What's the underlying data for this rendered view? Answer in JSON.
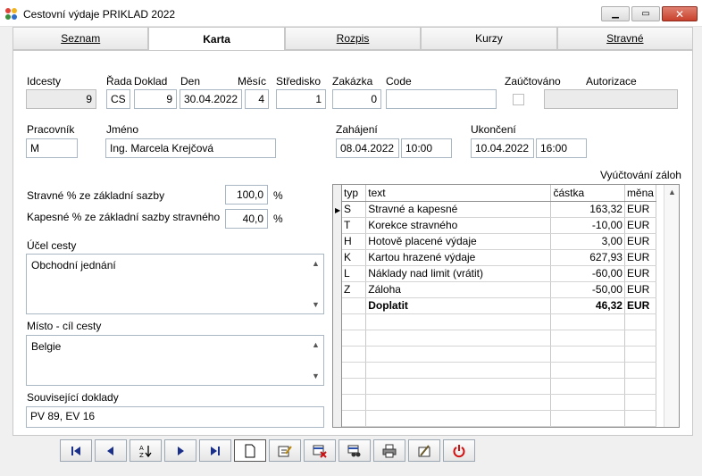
{
  "window": {
    "title": "Cestovní výdaje PRIKLAD 2022"
  },
  "tabs": [
    "Seznam",
    "Karta",
    "Rozpis",
    "Kurzy",
    "Stravné"
  ],
  "labels": {
    "idcesty": "Idcesty",
    "rada": "Řada",
    "doklad": "Doklad",
    "den": "Den",
    "mesic": "Měsíc",
    "stredisko": "Středisko",
    "zakazka": "Zakázka",
    "code": "Code",
    "zauctovano": "Zaúčtováno",
    "autorizace": "Autorizace",
    "pracovnik": "Pracovník",
    "jmeno": "Jméno",
    "zahajeni": "Zahájení",
    "ukonceni": "Ukončení",
    "vyuctovani": "Vyúčtování záloh",
    "stravne_pct": "Stravné % ze základní sazby",
    "kapesne_pct": "Kapesné % ze základní sazby stravného",
    "ucel": "Účel cesty",
    "misto": "Místo - cíl cesty",
    "souvisejici": "Související doklady",
    "percent": "%"
  },
  "fields": {
    "idcesty": "9",
    "rada": "CS",
    "doklad": "9",
    "den": "30.04.2022",
    "mesic": "4",
    "stredisko": "1",
    "zakazka": "0",
    "code": "",
    "autorizace": "",
    "pracovnik": "M",
    "jmeno": "Ing. Marcela Krejčová",
    "zahajeni_date": "08.04.2022",
    "zahajeni_time": "10:00",
    "ukonceni_date": "10.04.2022",
    "ukonceni_time": "16:00",
    "stravne_pct": "100,0",
    "kapesne_pct": "40,0",
    "ucel": "Obchodní jednání",
    "misto": "Belgie",
    "souvisejici": "PV 89, EV 16"
  },
  "grid": {
    "headers": [
      "typ",
      "text",
      "částka",
      "měna"
    ],
    "rows": [
      [
        "S",
        "Stravné a kapesné",
        "163,32",
        "EUR"
      ],
      [
        "T",
        "Korekce stravného",
        "-10,00",
        "EUR"
      ],
      [
        "H",
        "Hotově placené výdaje",
        "3,00",
        "EUR"
      ],
      [
        "K",
        "Kartou hrazené výdaje",
        "627,93",
        "EUR"
      ],
      [
        "L",
        "Náklady nad limit (vrátit)",
        "-60,00",
        "EUR"
      ],
      [
        "Z",
        "Záloha",
        "-50,00",
        "EUR"
      ],
      [
        "",
        "Doplatit",
        "46,32",
        "EUR"
      ]
    ]
  },
  "toolbar": [
    "first-record-icon",
    "prev-record-icon",
    "sort-az-icon",
    "next-record-icon",
    "last-record-icon",
    "new-record-icon",
    "edit-record-icon",
    "delete-record-icon",
    "find-icon",
    "print-icon",
    "tools-icon",
    "power-icon"
  ]
}
